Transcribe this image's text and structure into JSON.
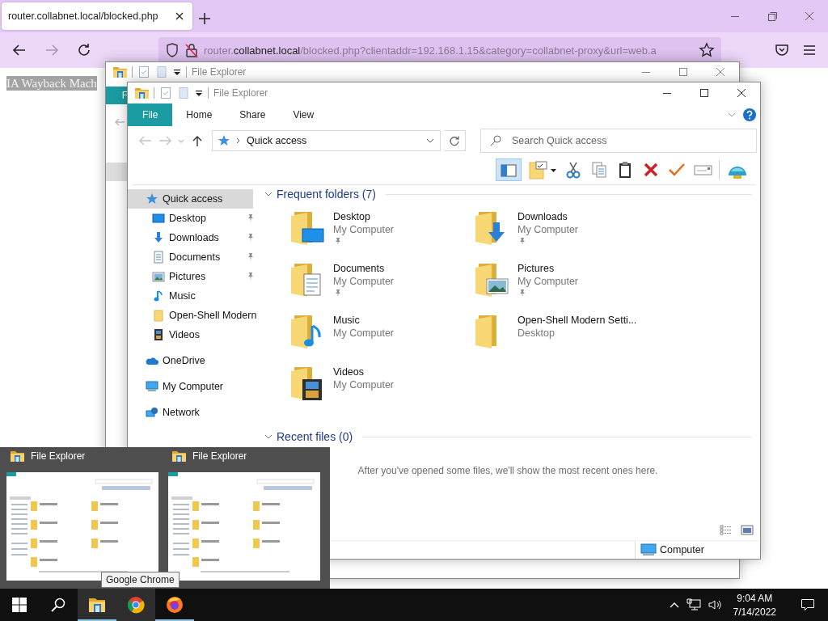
{
  "browser": {
    "tab": {
      "title": "router.collabnet.local/blocked.php"
    },
    "nav_buttons": [
      {
        "kind": "back",
        "disabled": false
      },
      {
        "kind": "forward",
        "disabled": true
      },
      {
        "kind": "reload",
        "disabled": false
      }
    ],
    "url": {
      "subdomain": "router.",
      "domain": "collabnet.local",
      "path": "/blocked.php?clientaddr=192.168.1.15&category=collabnet-proxy&url=web.a"
    },
    "page_text": "IA Wayback Mach"
  },
  "back_window": {
    "title": "File Explorer",
    "ribbon_tab": "F"
  },
  "explorer": {
    "title": "File Explorer",
    "ribbon_tabs": [
      {
        "label": "File",
        "kind": "file"
      },
      {
        "label": "Home",
        "kind": "tab"
      },
      {
        "label": "Share",
        "kind": "tab"
      },
      {
        "label": "View",
        "kind": "tab"
      }
    ],
    "history": [
      {
        "kind": "back",
        "disabled": true
      },
      {
        "kind": "forward",
        "disabled": true
      },
      {
        "kind": "recent",
        "disabled": true
      },
      {
        "kind": "up",
        "disabled": false
      }
    ],
    "address": "Quick access",
    "search": {
      "placeholder": "Search Quick access"
    },
    "toolbar": [
      {
        "kind": "pane",
        "selected": true
      },
      {
        "kind": "properties",
        "selected": false
      },
      {
        "kind": "cut",
        "selected": false
      },
      {
        "kind": "copy",
        "selected": false
      },
      {
        "kind": "paste",
        "selected": false
      },
      {
        "kind": "delete",
        "selected": false
      },
      {
        "kind": "check",
        "selected": false
      },
      {
        "kind": "rename",
        "selected": false
      },
      {
        "kind": "shell",
        "selected": false
      }
    ],
    "nav": [
      {
        "label": "Quick access",
        "kind": "quick",
        "selected": true,
        "children": [
          {
            "label": "Desktop",
            "kind": "desktop",
            "pinned": true,
            "selected": false
          },
          {
            "label": "Downloads",
            "kind": "downloads",
            "pinned": true,
            "selected": false
          },
          {
            "label": "Documents",
            "kind": "documents",
            "pinned": true,
            "selected": false
          },
          {
            "label": "Pictures",
            "kind": "pictures",
            "pinned": true,
            "selected": false
          },
          {
            "label": "Music",
            "kind": "music",
            "pinned": false,
            "selected": false
          },
          {
            "label": "Open-Shell Modern",
            "kind": "folder",
            "pinned": false,
            "selected": false
          },
          {
            "label": "Videos",
            "kind": "videos",
            "pinned": false,
            "selected": false
          }
        ]
      },
      {
        "label": "OneDrive",
        "kind": "onedrive",
        "selected": false
      },
      {
        "label": "My Computer",
        "kind": "computer",
        "selected": false
      },
      {
        "label": "Network",
        "kind": "network",
        "selected": false
      }
    ],
    "sections": [
      {
        "title": "Frequent folders (7)",
        "expanded": true,
        "folders": [
          {
            "name": "Desktop",
            "location": "My Computer",
            "kind": "desktop",
            "pinned": true
          },
          {
            "name": "Downloads",
            "location": "My Computer",
            "kind": "downloads",
            "pinned": true
          },
          {
            "name": "Documents",
            "location": "My Computer",
            "kind": "documents",
            "pinned": true
          },
          {
            "name": "Pictures",
            "location": "My Computer",
            "kind": "pictures",
            "pinned": true
          },
          {
            "name": "Music",
            "location": "My Computer",
            "kind": "music",
            "pinned": false
          },
          {
            "name": "Open-Shell Modern Setti...",
            "location": "Desktop",
            "kind": "folder",
            "pinned": false
          },
          {
            "name": "Videos",
            "location": "My Computer",
            "kind": "videos",
            "pinned": false
          }
        ]
      },
      {
        "title": "Recent files (0)",
        "expanded": true,
        "message": "After you've opened some files, we'll show the most recent ones here."
      }
    ],
    "status": "Computer"
  },
  "thumbnails": [
    {
      "title": "File Explorer"
    },
    {
      "title": "File Explorer"
    }
  ],
  "tooltip": "Google Chrome",
  "taskbar": {
    "apps": [
      {
        "kind": "explorer",
        "running": true,
        "highlighted": true
      },
      {
        "kind": "chrome",
        "running": false,
        "highlighted": true
      },
      {
        "kind": "firefox",
        "running": true,
        "highlighted": false
      }
    ],
    "time": "9:04 AM",
    "date": "7/14/2022"
  }
}
